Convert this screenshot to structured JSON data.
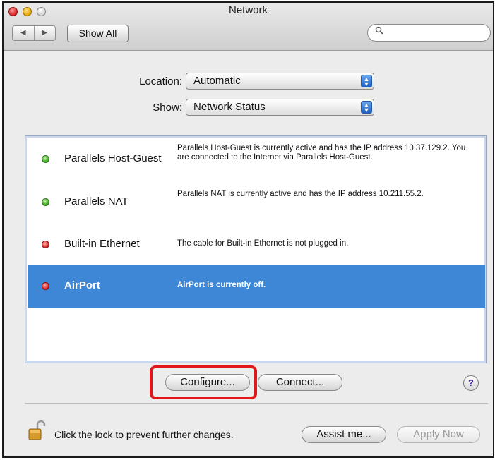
{
  "window": {
    "title": "Network"
  },
  "toolbar": {
    "back_glyph": "◀",
    "forward_glyph": "▶",
    "show_all_label": "Show All",
    "search_placeholder": "",
    "search_icon": "search-icon"
  },
  "location": {
    "label": "Location:",
    "selected": "Automatic"
  },
  "show": {
    "label": "Show:",
    "selected": "Network Status"
  },
  "services": [
    {
      "name": "Parallels Host-Guest",
      "status": "green",
      "description": "Parallels Host-Guest is currently active and has the IP address 10.37.129.2. You are connected to the Internet via Parallels Host-Guest.",
      "selected": false
    },
    {
      "name": "Parallels NAT",
      "status": "green",
      "description": "Parallels NAT is currently active and has the IP address 10.211.55.2.",
      "selected": false
    },
    {
      "name": "Built-in Ethernet",
      "status": "red",
      "description": "The cable for Built-in Ethernet is not plugged in.",
      "selected": false
    },
    {
      "name": "AirPort",
      "status": "red",
      "description": "AirPort is currently off.",
      "selected": true
    }
  ],
  "actions": {
    "configure_label": "Configure...",
    "connect_label": "Connect...",
    "help_label": "?"
  },
  "footer": {
    "lock_text": "Click the lock to prevent further changes.",
    "assist_label": "Assist me...",
    "apply_label": "Apply Now"
  },
  "colors": {
    "selection": "#3e87d6",
    "highlight_box": "#e0161b",
    "status_green": "#37a11a",
    "status_red": "#d11a1a"
  }
}
